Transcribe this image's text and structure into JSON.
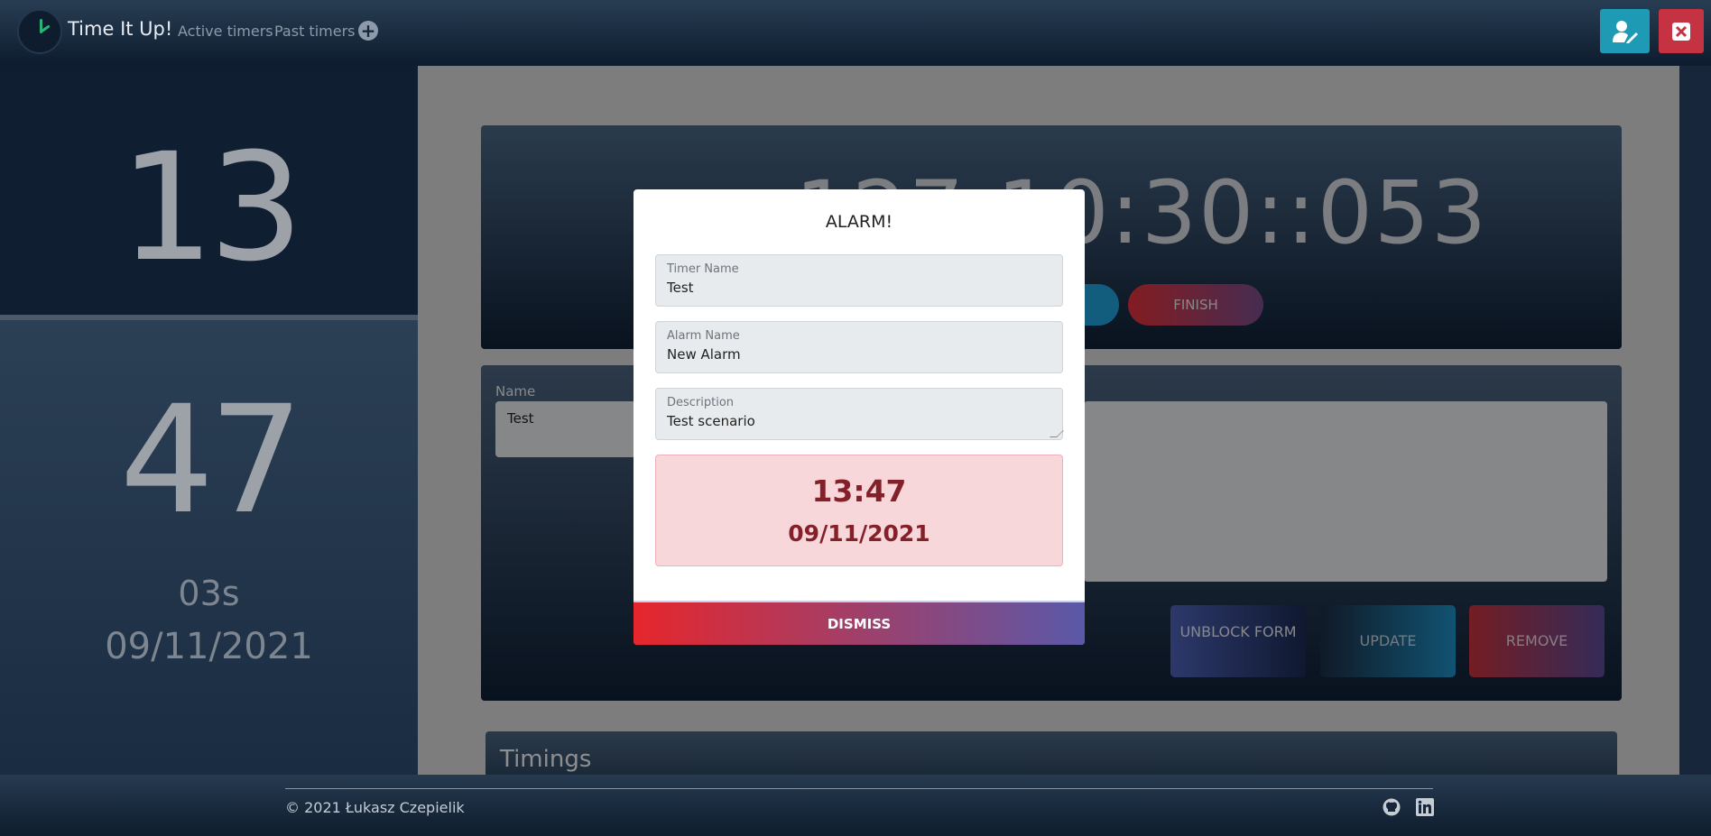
{
  "navbar": {
    "brand": "Time It Up!",
    "links": [
      "Active timers",
      "Past timers"
    ],
    "add_icon": "plus-circle-icon",
    "user_button_icon": "user-edit-icon",
    "close_button_icon": "close-x-icon"
  },
  "left_panel": {
    "hours": "13",
    "minutes": "47",
    "seconds": "03s",
    "date": "09/11/2021"
  },
  "timer_card": {
    "time": "127:10:30::053",
    "finish_label": "FINISH"
  },
  "form": {
    "name_label": "Name",
    "name_value": "Test",
    "unblock_label": "UNBLOCK FORM",
    "update_label": "UPDATE",
    "remove_label": "REMOVE"
  },
  "timings": {
    "title": "Timings"
  },
  "modal": {
    "title": "ALARM!",
    "timer_name_label": "Timer Name",
    "timer_name_value": "Test",
    "alarm_name_label": "Alarm Name",
    "alarm_name_value": "New Alarm",
    "description_label": "Description",
    "description_value": "Test scenario",
    "alarm_time": "13:47",
    "alarm_date": "09/11/2021",
    "dismiss_label": "DISMISS"
  },
  "footer": {
    "copyright": "© 2021 Łukasz Czepielik",
    "github_icon": "github-icon",
    "linkedin_icon": "linkedin-icon"
  },
  "colors": {
    "danger": "#c53242",
    "info": "#1e9ab5",
    "alert_bg": "#f8d7da",
    "alert_text": "#842029"
  }
}
